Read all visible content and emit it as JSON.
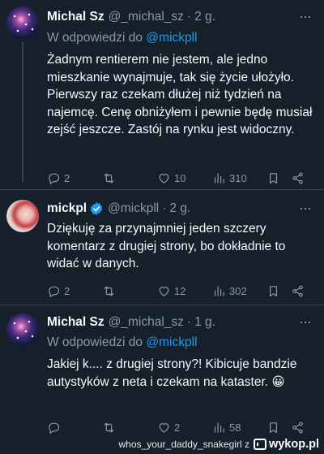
{
  "tweets": [
    {
      "name": "Michal Sz",
      "handle": "@_michal_sz",
      "separator": "·",
      "time": "2 g.",
      "reply_prefix": "W odpowiedzi do",
      "reply_mention": "@mickpll",
      "text": "Żadnym rentierem nie jestem, ale jedno mieszkanie wynajmuje, tak się życie ułożyło. Pierwszy raz czekam dłużej niż tydzień na najemcę. Cenę obniżyłem i pewnie będę musiał zejść jeszcze. Zastój na rynku jest widoczny.",
      "replies": "2",
      "reposts": "",
      "likes": "10",
      "views": "310",
      "verified": false,
      "avatar": "galaxy-avatar"
    },
    {
      "name": "mickpl",
      "handle": "@mickpll",
      "separator": "·",
      "time": "2 g.",
      "text": "Dziękuję za przynajmniej jeden szczery komentarz z drugiej strony, bo dokładnie to widać w danych.",
      "replies": "2",
      "reposts": "",
      "likes": "12",
      "views": "302",
      "verified": true,
      "avatar": "mickpl-avatar"
    },
    {
      "name": "Michal Sz",
      "handle": "@_michal_sz",
      "separator": "·",
      "time": "1 g.",
      "reply_prefix": "W odpowiedzi do",
      "reply_mention": "@mickpll",
      "text": "Jakiej k.... z drugiej strony?! Kibicuje bandzie autystyków z neta i czekam na kataster. 😀",
      "replies": "",
      "reposts": "",
      "likes": "2",
      "views": "58",
      "verified": false,
      "avatar": "galaxy-avatar"
    }
  ],
  "more_glyph": "···",
  "watermark": {
    "user": "whos_your_daddy_snakegirl z",
    "site": "wykop.pl"
  },
  "colors": {
    "background": "#15202b",
    "accent": "#1d9bf0",
    "muted": "#8b98a5",
    "border": "#38444d"
  }
}
